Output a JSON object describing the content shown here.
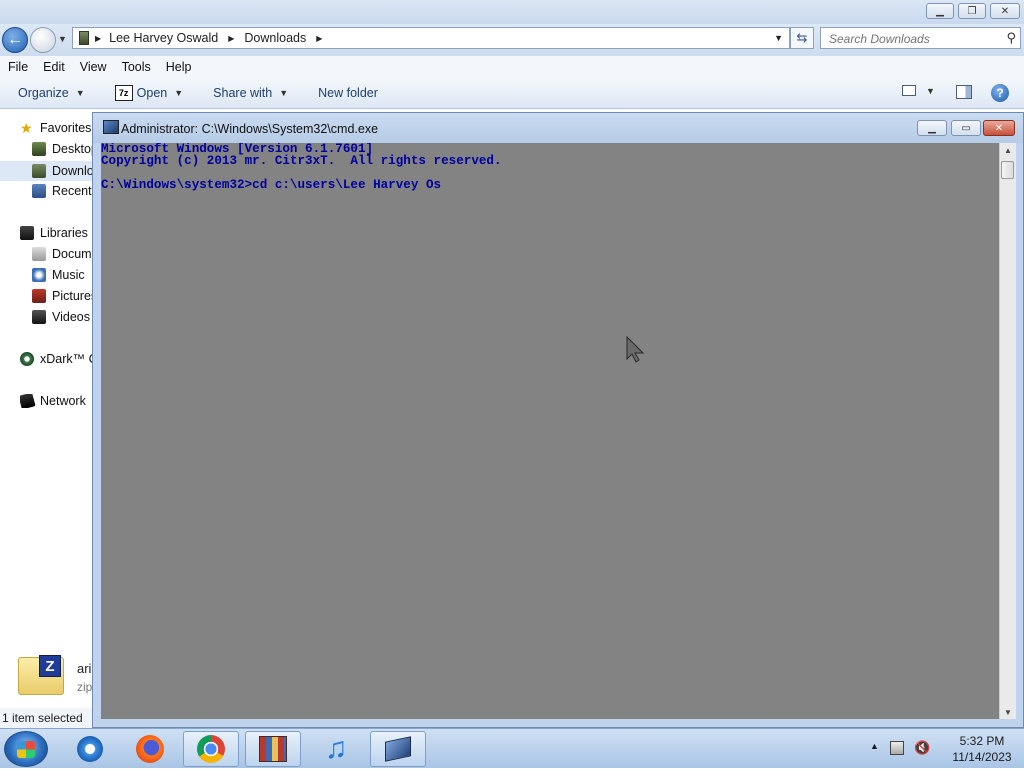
{
  "explorer": {
    "breadcrumb": [
      "Lee Harvey Oswald",
      "Downloads"
    ],
    "search_placeholder": "Search Downloads",
    "menu": [
      "File",
      "Edit",
      "View",
      "Tools",
      "Help"
    ],
    "toolbar": {
      "organize": "Organize",
      "open": "Open",
      "open_icon_text": "7z",
      "share": "Share with",
      "new_folder": "New folder"
    },
    "nav": {
      "favorites": "Favorites",
      "desktop": "Desktop",
      "downloads": "Downlo",
      "recent": "Recent",
      "libraries": "Libraries",
      "documents": "Docum",
      "music": "Music",
      "pictures": "Pictures",
      "videos": "Videos",
      "homegroup": "xDark™ C",
      "network": "Network"
    },
    "details": {
      "name": "ari",
      "type": "zip",
      "icon_letter": "Z"
    },
    "status": "1 item selected"
  },
  "cmd": {
    "title": "Administrator: C:\\Windows\\System32\\cmd.exe",
    "lines": [
      "Microsoft Windows [Version 6.1.7601]",
      "Copyright (c) 2013 mr. Citr3xT.  All rights reserved.",
      "",
      "C:\\Windows\\system32>cd c:\\users\\Lee Harvey Os"
    ]
  },
  "taskbar": {
    "apps": [
      "internet-explorer",
      "firefox",
      "chrome",
      "archive-manager",
      "media-player",
      "command-prompt"
    ],
    "time": "5:32 PM",
    "date": "11/14/2023"
  },
  "colors": {
    "console_bg": "#838383",
    "console_text": "#00009e",
    "title_bar": "#c9d9ee"
  }
}
